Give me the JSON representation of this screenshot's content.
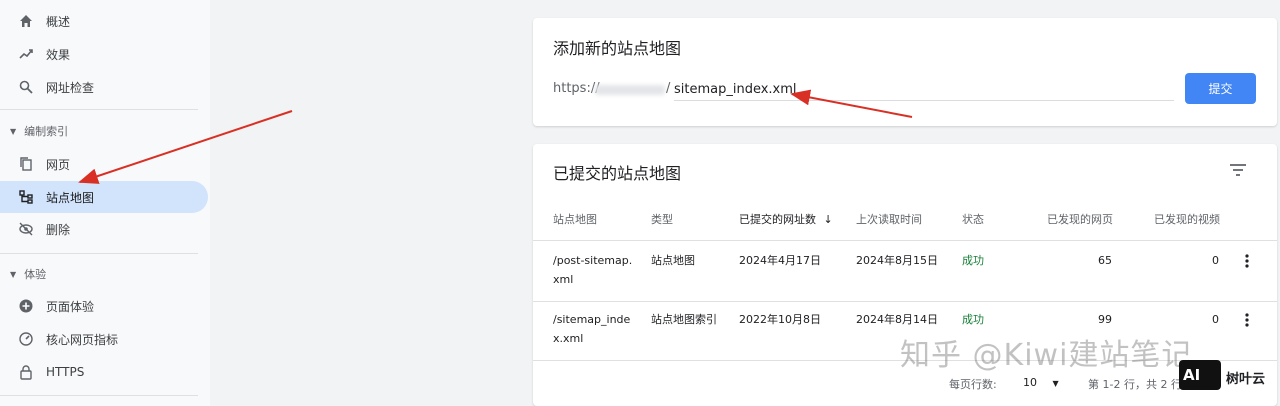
{
  "sidebar": {
    "items": [
      {
        "label": "概述",
        "icon": "home-icon"
      },
      {
        "label": "效果",
        "icon": "trending-icon"
      },
      {
        "label": "网址检查",
        "icon": "search-icon"
      }
    ],
    "sections": [
      {
        "label": "编制索引",
        "items": [
          {
            "label": "网页",
            "icon": "pages-icon"
          },
          {
            "label": "站点地图",
            "icon": "sitemap-icon",
            "active": true
          },
          {
            "label": "删除",
            "icon": "remove-icon"
          }
        ]
      },
      {
        "label": "体验",
        "items": [
          {
            "label": "页面体验",
            "icon": "plus-circle-icon"
          },
          {
            "label": "核心网页指标",
            "icon": "gauge-icon"
          },
          {
            "label": "HTTPS",
            "icon": "lock-icon"
          }
        ]
      }
    ]
  },
  "add_card": {
    "title": "添加新的站点地图",
    "url_prefix": "https://",
    "url_separator": "/",
    "input_value": "sitemap_index.xml",
    "submit_label": "提交"
  },
  "submitted_card": {
    "title": "已提交的站点地图",
    "columns": [
      "站点地图",
      "类型",
      "已提交的网址数",
      "上次读取时间",
      "状态",
      "已发现的网页",
      "已发现的视频"
    ],
    "sorted_column_arrow": "↓",
    "rows": [
      {
        "sitemap": [
          "/post-sitemap.",
          "xml"
        ],
        "type": "站点地图",
        "submitted": "2024年4月17日",
        "last_read": "2024年8月15日",
        "status": "成功",
        "pages": "65",
        "videos": "0"
      },
      {
        "sitemap": [
          "/sitemap_inde",
          "x.xml"
        ],
        "type": "站点地图索引",
        "submitted": "2022年10月8日",
        "last_read": "2024年8月14日",
        "status": "成功",
        "pages": "99",
        "videos": "0"
      }
    ],
    "footer": {
      "rows_per_page_label": "每页行数:",
      "rows_per_page_value": "10",
      "range_text": "第 1-2 行，共 2 行"
    }
  },
  "watermark": {
    "text": "知乎 @Kiwi建站笔记",
    "badge": "AI",
    "badge_caption": "树叶云"
  },
  "colors": {
    "accent": "#4285f4",
    "active_nav": "#d2e3fc",
    "success": "#188038",
    "annotation_arrow": "#d93025"
  }
}
